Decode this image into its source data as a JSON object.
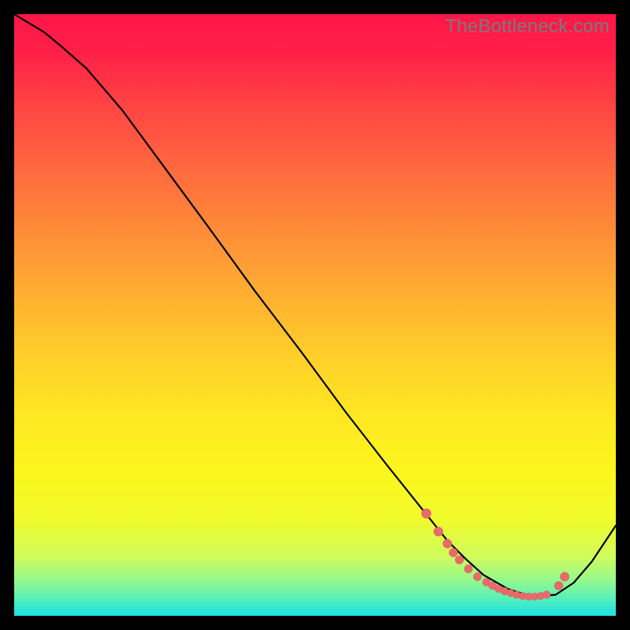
{
  "watermark": "TheBottleneck.com",
  "chart_data": {
    "type": "line",
    "title": "",
    "xlabel": "",
    "ylabel": "",
    "xlim": [
      0,
      100
    ],
    "ylim": [
      0,
      100
    ],
    "grid": false,
    "series": [
      {
        "name": "curve",
        "x": [
          0,
          5,
          8,
          12,
          18,
          25,
          32,
          40,
          48,
          55,
          62,
          68,
          72,
          75,
          78,
          82,
          86,
          90,
          93,
          96,
          100
        ],
        "y": [
          100,
          97,
          94.5,
          91,
          84,
          74.5,
          65,
          54,
          43.5,
          34,
          25,
          17.5,
          12.5,
          9.5,
          6.8,
          4.5,
          3.2,
          3.5,
          5.5,
          9,
          15
        ]
      }
    ],
    "scatter": {
      "name": "points",
      "x": [
        68.5,
        70.5,
        72.0,
        73.0,
        74.0,
        75.5,
        77.0,
        78.5,
        79.5,
        80.5,
        81.5,
        82.5,
        83.5,
        84.5,
        85.5,
        86.5,
        87.5,
        88.5,
        90.5,
        91.5
      ],
      "y": [
        17.0,
        14.0,
        12.0,
        10.5,
        9.3,
        7.8,
        6.5,
        5.6,
        5.0,
        4.5,
        4.1,
        3.8,
        3.5,
        3.3,
        3.2,
        3.2,
        3.3,
        3.5,
        5.0,
        6.5
      ],
      "r": [
        6.2,
        6.0,
        5.8,
        5.6,
        5.5,
        5.4,
        5.3,
        5.2,
        5.1,
        5.0,
        5.0,
        4.9,
        4.9,
        4.8,
        4.8,
        4.8,
        4.8,
        5.0,
        5.6,
        5.8
      ]
    }
  }
}
